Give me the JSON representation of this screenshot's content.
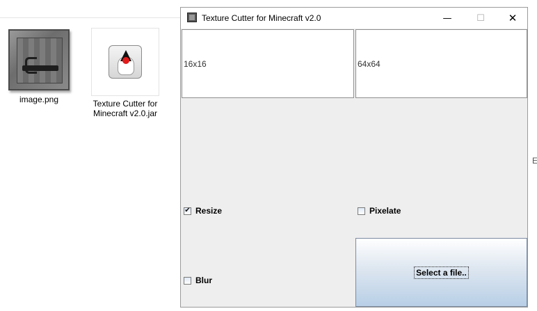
{
  "desktop": {
    "files": [
      {
        "name": "image.png"
      },
      {
        "name_line1": "Texture Cutter for",
        "name_line2": "Minecraft v2.0.jar"
      }
    ],
    "edge_text": "E"
  },
  "window": {
    "title": "Texture Cutter for Minecraft v2.0",
    "controls": {
      "minimize": "—",
      "maximize": "☐",
      "close": "✕"
    },
    "labels": {
      "small": "16x16",
      "large": "64x64"
    },
    "options": {
      "resize": {
        "label": "Resize",
        "checked": true
      },
      "pixelate": {
        "label": "Pixelate",
        "checked": false
      },
      "blur": {
        "label": "Blur",
        "checked": false
      }
    },
    "select_button": "Select a file.."
  },
  "icons": {
    "app": "app-icon",
    "png_file": "image-file-icon",
    "jar_file": "java-jar-icon"
  }
}
